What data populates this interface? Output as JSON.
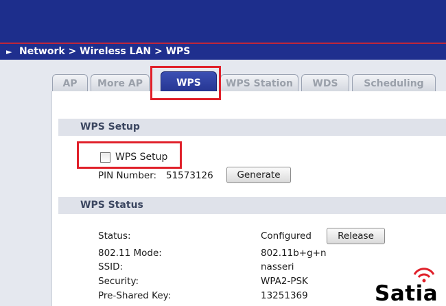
{
  "breadcrumb": {
    "text": "Network > Wireless LAN > WPS"
  },
  "tabs": [
    {
      "label": "AP"
    },
    {
      "label": "More AP"
    },
    {
      "label": "WPS"
    },
    {
      "label": "WPS Station"
    },
    {
      "label": "WDS"
    },
    {
      "label": "Scheduling"
    }
  ],
  "active_tab": "WPS",
  "wps_setup": {
    "section_title": "WPS Setup",
    "checkbox_label": "WPS Setup",
    "checkbox_checked": false,
    "pin_label": "PIN Number:",
    "pin_value": "51573126",
    "generate_label": "Generate"
  },
  "wps_status": {
    "section_title": "WPS Status",
    "status_label": "Status:",
    "status_value": "Configured",
    "release_label": "Release",
    "mode_label": "802.11 Mode:",
    "mode_value": "802.11b+g+n",
    "ssid_label": "SSID:",
    "ssid_value": "nasseri",
    "security_label": "Security:",
    "security_value": "WPA2-PSK",
    "psk_label": "Pre-Shared Key:",
    "psk_value": "13251369"
  },
  "logo": {
    "text": "Satia"
  },
  "colors": {
    "header": "#1d2e8c",
    "highlight": "#e0202a",
    "logo_signal": "#e0202a"
  }
}
